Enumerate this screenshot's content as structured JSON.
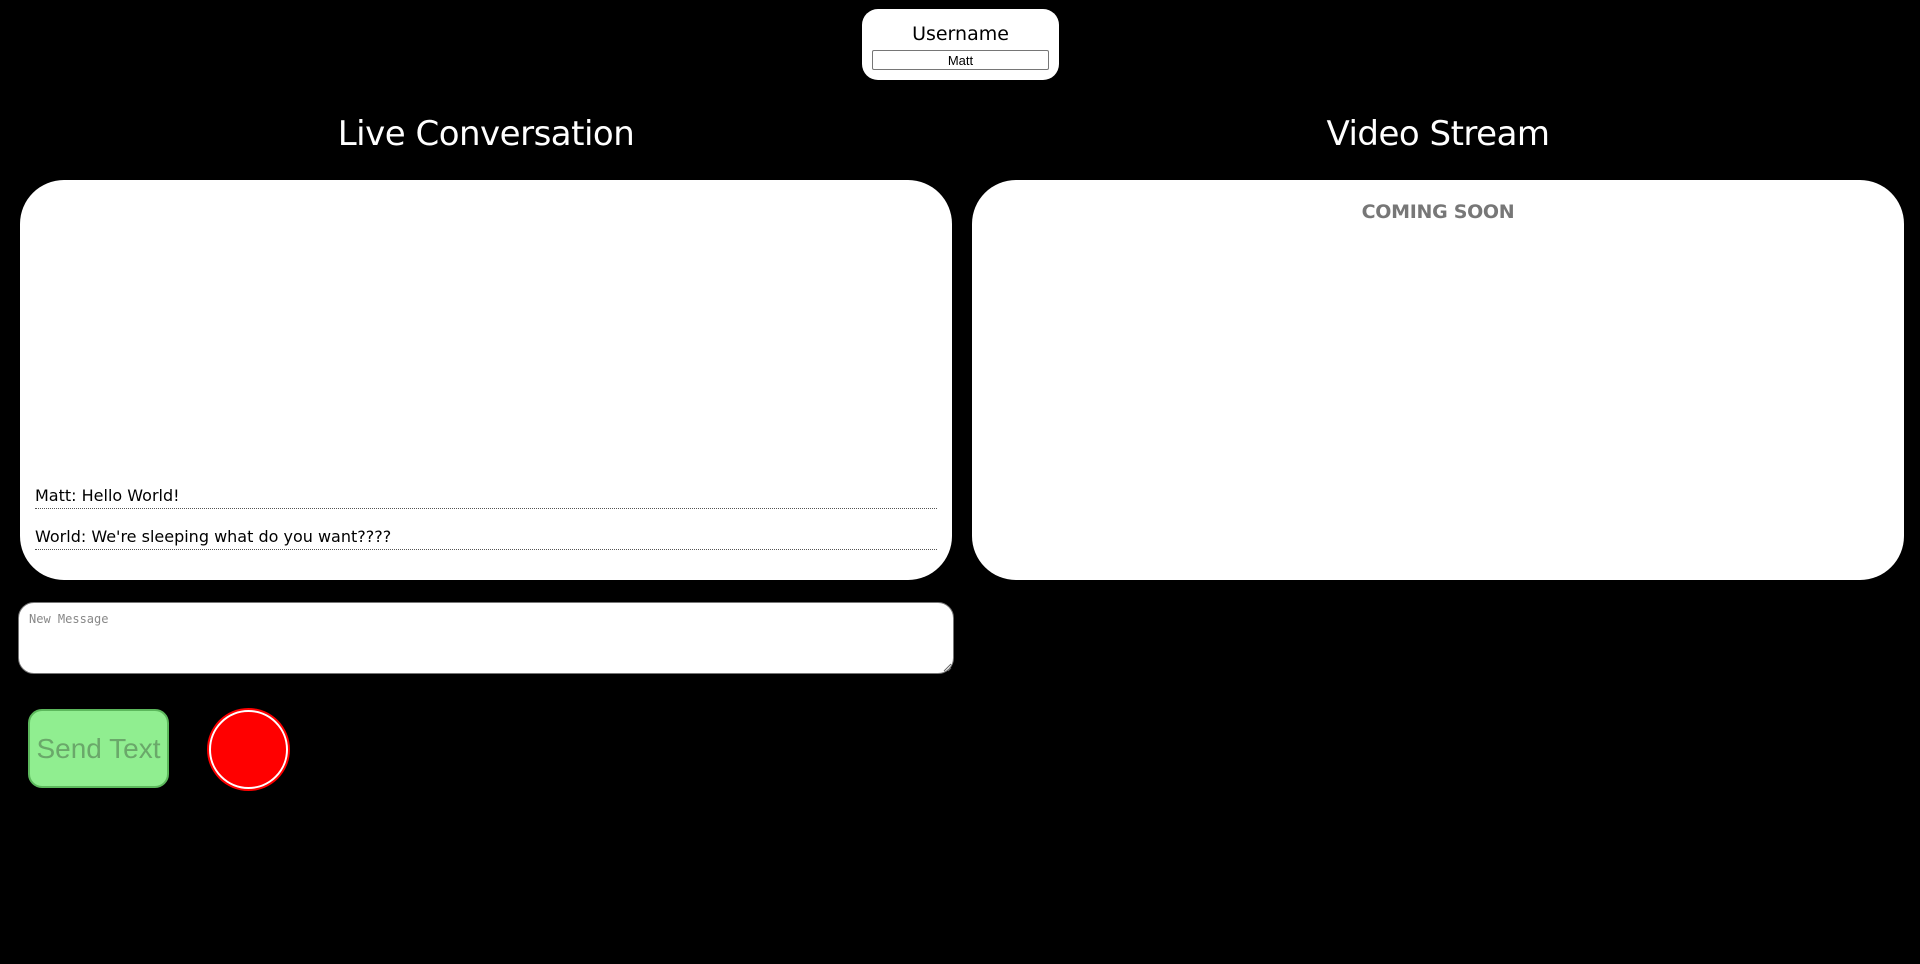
{
  "username": {
    "label": "Username",
    "value": "Matt"
  },
  "conversation": {
    "heading": "Live Conversation",
    "messages": [
      {
        "text": "Matt: Hello World!"
      },
      {
        "text": "World: We're sleeping what do you want????"
      }
    ]
  },
  "video": {
    "heading": "Video Stream",
    "status": "COMING SOON"
  },
  "composer": {
    "placeholder": "New Message",
    "send_label": "Send Text"
  },
  "colors": {
    "background": "#000000",
    "panel": "#ffffff",
    "send_button": "#90ee90",
    "record_button": "#ff0000"
  }
}
